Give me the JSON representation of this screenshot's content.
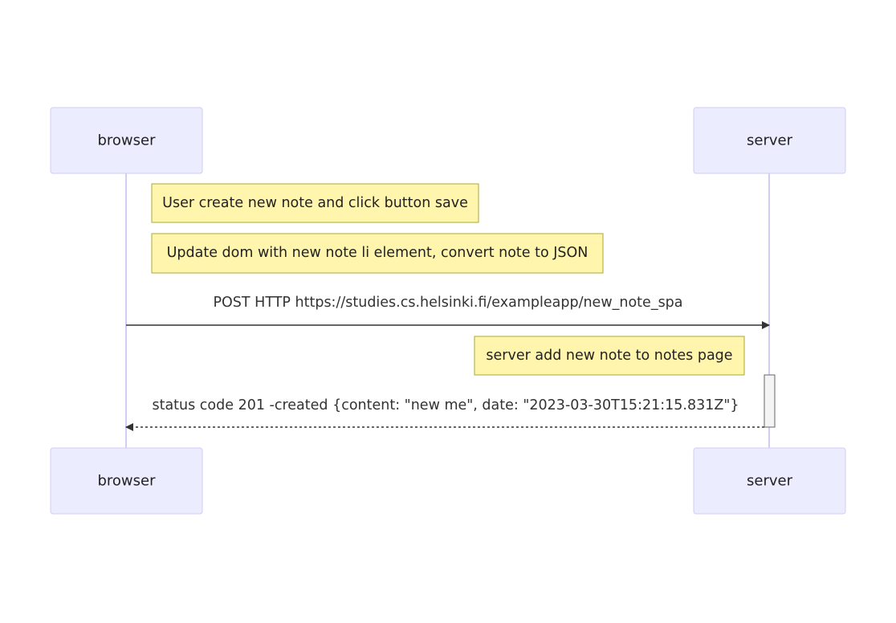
{
  "participants": [
    {
      "id": "browser",
      "label": "browser"
    },
    {
      "id": "server",
      "label": "server"
    }
  ],
  "notes": [
    {
      "over": "browser",
      "text": "User create new note and click button save"
    },
    {
      "over": "browser",
      "text": "Update dom with new note li element, convert note to JSON"
    },
    {
      "over": "server",
      "text": "server add new note to notes page"
    }
  ],
  "messages": [
    {
      "from": "browser",
      "to": "server",
      "text": "POST HTTP https://studies.cs.helsinki.fi/exampleapp/new_note_spa",
      "style": "solid"
    },
    {
      "from": "server",
      "to": "browser",
      "text": "status code 201 -created {content: \"new me\", date: \"2023-03-30T15:21:15.831Z\"}",
      "style": "dashed"
    }
  ],
  "colors": {
    "actor_fill": "#ececff",
    "actor_stroke": "#d2cdf4",
    "note_fill": "#fff5ad",
    "note_stroke": "#aaaa33",
    "line": "#333333"
  }
}
